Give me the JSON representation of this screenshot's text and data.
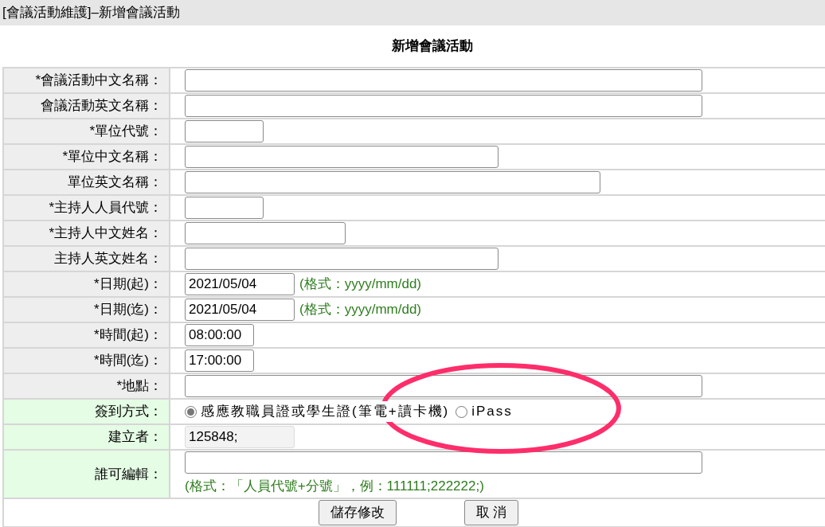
{
  "title_bar": "[會議活動維護]–新增會議活動",
  "heading": "新增會議活動",
  "rows": [
    {
      "label": "*會議活動中文名稱：",
      "kind": "text",
      "color": "#eeeeee"
    },
    {
      "label": "會議活動英文名稱：",
      "kind": "text",
      "color": "#eeeeee"
    },
    {
      "label": "*單位代號：",
      "kind": "text",
      "color": "#eeeeee"
    },
    {
      "label": "*單位中文名稱：",
      "kind": "text",
      "color": "#eeeeee"
    },
    {
      "label": "單位英文名稱：",
      "kind": "text",
      "color": "#eeeeee"
    },
    {
      "label": "*主持人人員代號：",
      "kind": "text",
      "color": "#eeeeee"
    },
    {
      "label": "*主持人中文姓名：",
      "kind": "text",
      "color": "#eeeeee"
    },
    {
      "label": "主持人英文姓名：",
      "kind": "text",
      "color": "#eeeeee"
    },
    {
      "label": "*日期(起)：",
      "kind": "text",
      "value": "2021/05/04",
      "hint": "(格式：yyyy/mm/dd)",
      "color": "#eeeeee"
    },
    {
      "label": "*日期(迄)：",
      "kind": "text",
      "value": "2021/05/04",
      "hint": "(格式：yyyy/mm/dd)",
      "color": "#eeeeee"
    },
    {
      "label": "*時間(起)：",
      "kind": "text",
      "value": "08:00:00",
      "color": "#eeeeee"
    },
    {
      "label": "*時間(迄)：",
      "kind": "text",
      "value": "17:00:00",
      "color": "#eeeeee"
    },
    {
      "label": "*地點：",
      "kind": "text",
      "color": "#eeeeee"
    },
    {
      "label": "簽到方式：",
      "kind": "radio",
      "color": "#e5fce5",
      "options": [
        {
          "label": "感應教職員證或學生證(筆電+讀卡機)",
          "selected": true
        },
        {
          "label": "iPass",
          "selected": false
        }
      ]
    },
    {
      "label": "建立者：",
      "kind": "readonly",
      "value": "125848;",
      "color": "#e5fce5"
    },
    {
      "label": "誰可編輯：",
      "kind": "text",
      "hint_below": "(格式：「人員代號+分號」，例：111111;222222;)",
      "color": "#e5fce5"
    }
  ],
  "buttons": [
    "儲存修改",
    "取 消"
  ]
}
